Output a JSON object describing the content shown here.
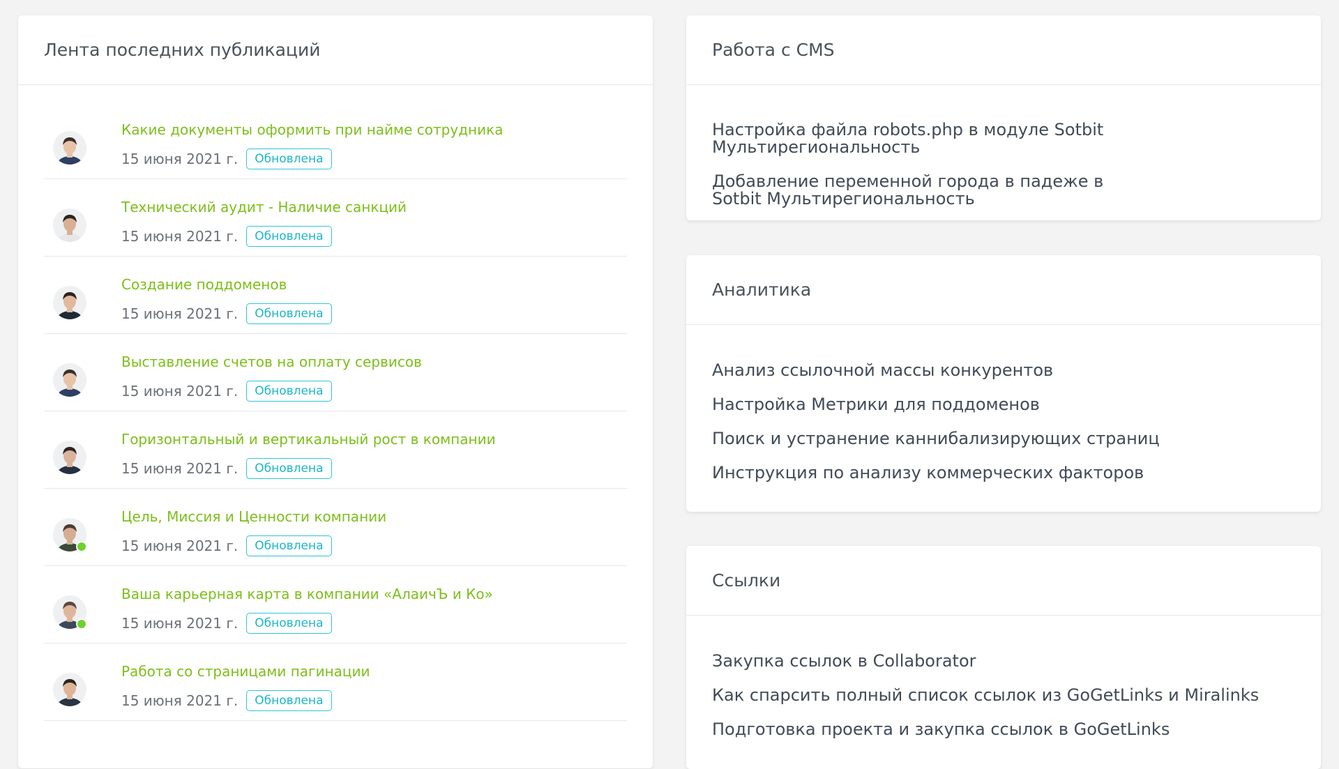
{
  "feed": {
    "title": "Лента последних публикаций",
    "items": [
      {
        "title": "Какие документы оформить при найме сотрудника",
        "date": "15 июня 2021 г.",
        "badge": "Обновлена",
        "online": false
      },
      {
        "title": "Технический аудит - Наличие санкций",
        "date": "15 июня 2021 г.",
        "badge": "Обновлена",
        "online": false
      },
      {
        "title": "Создание поддоменов",
        "date": "15 июня 2021 г.",
        "badge": "Обновлена",
        "online": false
      },
      {
        "title": "Выставление счетов на оплату сервисов",
        "date": "15 июня 2021 г.",
        "badge": "Обновлена",
        "online": false
      },
      {
        "title": "Горизонтальный и вертикальный рост в компании",
        "date": "15 июня 2021 г.",
        "badge": "Обновлена",
        "online": false
      },
      {
        "title": "Цель, Миссия и Ценности компании",
        "date": "15 июня 2021 г.",
        "badge": "Обновлена",
        "online": true
      },
      {
        "title": "Ваша карьерная карта в компании «АлаичЪ и Ко»",
        "date": "15 июня 2021 г.",
        "badge": "Обновлена",
        "online": true
      },
      {
        "title": "Работа со страницами пагинации",
        "date": "15 июня 2021 г.",
        "badge": "Обновлена",
        "online": false
      }
    ]
  },
  "cms": {
    "title": "Работа с CMS",
    "items": [
      "Настройка файла robots.php в модуле Sotbit Мультирегиональность",
      "Добавление переменной города в падеже в Sotbit Мультирегиональность"
    ]
  },
  "analytics": {
    "title": "Аналитика",
    "items": [
      "Анализ ссылочной массы конкурентов",
      "Настройка Метрики для поддоменов",
      "Поиск и устранение каннибализирующих страниц",
      "Инструкция по анализу коммерческих факторов"
    ]
  },
  "links": {
    "title": "Ссылки",
    "items": [
      "Закупка ссылок в Collaborator",
      "Как спарсить полный список ссылок из GoGetLinks и Miralinks",
      "Подготовка проекта и закупка ссылок в GoGetLinks"
    ]
  },
  "colors": {
    "page_bg": "#f3f3f4",
    "link_green": "#7cbf1a",
    "badge_teal": "#1cb6c6",
    "online_dot": "#6fd22b"
  }
}
